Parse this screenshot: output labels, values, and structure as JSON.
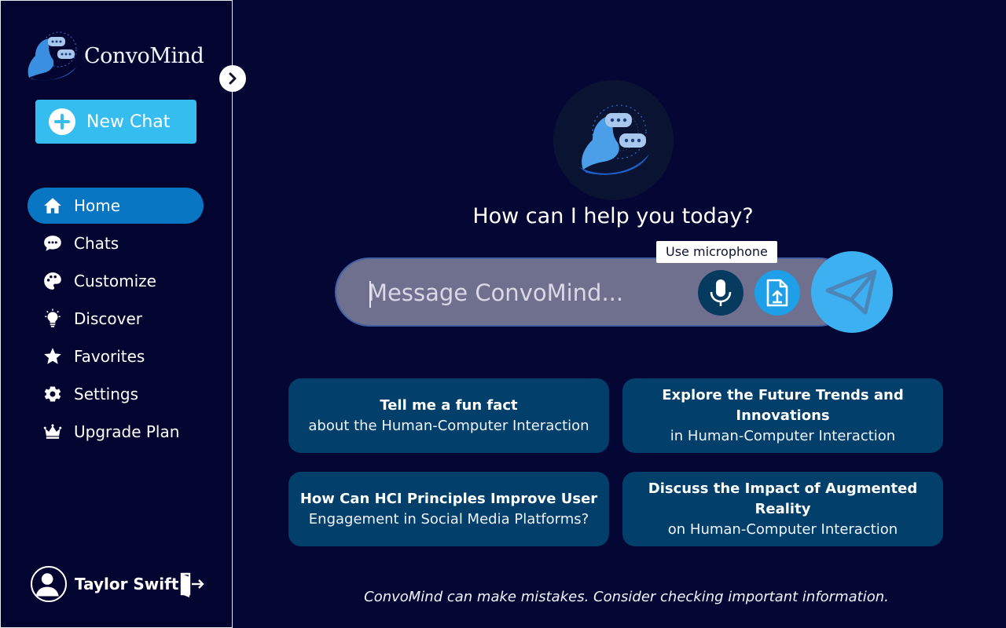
{
  "app": {
    "name": "ConvoMind"
  },
  "sidebar": {
    "new_chat_label": "New Chat",
    "items": [
      {
        "label": "Home",
        "icon": "home-icon",
        "active": true
      },
      {
        "label": "Chats",
        "icon": "chat-bubble-icon",
        "active": false
      },
      {
        "label": "Customize",
        "icon": "palette-icon",
        "active": false
      },
      {
        "label": "Discover",
        "icon": "lightbulb-icon",
        "active": false
      },
      {
        "label": "Favorites",
        "icon": "star-icon",
        "active": false
      },
      {
        "label": "Settings",
        "icon": "gear-icon",
        "active": false
      },
      {
        "label": "Upgrade Plan",
        "icon": "crown-icon",
        "active": false
      }
    ],
    "user": {
      "name": "Taylor Swift"
    }
  },
  "main": {
    "greeting": "How can I help you today?",
    "composer": {
      "placeholder": "Message ConvoMind..."
    },
    "tooltip": "Use microphone",
    "suggestions": [
      {
        "title": "Tell me a fun fact",
        "subtitle": "about the Human-Computer Interaction"
      },
      {
        "title": "Explore the Future Trends and Innovations",
        "subtitle": "in Human-Computer Interaction"
      },
      {
        "title": "How Can HCI Principles Improve User",
        "subtitle": "Engagement in Social Media Platforms?"
      },
      {
        "title": "Discuss the Impact of Augmented Reality",
        "subtitle": "on Human-Computer Interaction"
      }
    ],
    "disclaimer": "ConvoMind can make mistakes. Consider checking important information."
  },
  "colors": {
    "background": "#040634",
    "accent": "#35bdf0",
    "active_nav": "#0976c4",
    "card": "#033f6b"
  }
}
